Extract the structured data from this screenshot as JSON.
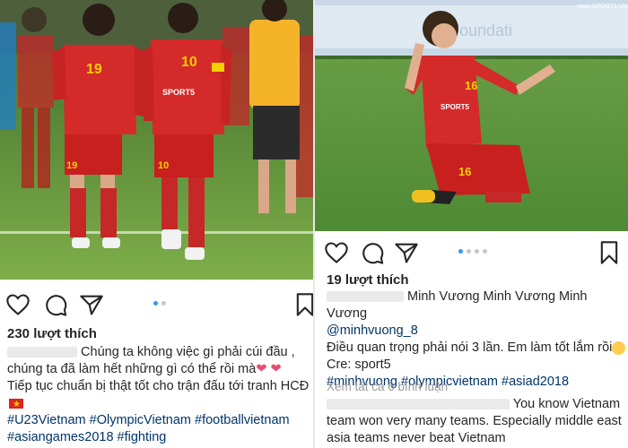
{
  "left_post": {
    "photo": {
      "players": [
        {
          "number": "19",
          "sponsor": "SPORT5"
        },
        {
          "number": "10",
          "sponsor": "SPORT5"
        },
        {
          "number": "19",
          "sponsor": "SPORT5"
        },
        {
          "number": "10",
          "sponsor": "SPORT5"
        }
      ]
    },
    "carousel": {
      "count": 2,
      "active": 0
    },
    "likes": "230 lượt thích",
    "caption_lines": [
      "Chúng ta không việc gì phải cúi đầu ,",
      "chúng ta đã làm hết những gì có thể rồi mà",
      "Tiếp tục chuẩn bị thật tốt cho trận đấu tới tranh HCĐ"
    ],
    "hashtags_line1": "#U23Vietnam #OlympicVietnam #footballvietnam",
    "hashtags_line2": "#asiangames2018 #fighting"
  },
  "right_post": {
    "photo": {
      "watermark": "www.SPORT5.VN",
      "players": [
        {
          "number": "16",
          "sponsor": "SPORT5"
        },
        {
          "number": "16",
          "sponsor": "SPORT5"
        }
      ]
    },
    "carousel": {
      "count": 4,
      "active": 0
    },
    "likes": "19 lượt thích",
    "caption_name": "Minh Vương Minh Vương Minh Vương",
    "mention": "@minhvuong_8",
    "caption_line": "Điều quan trọng phải nói 3 lần. Em làm tốt lắm rồi",
    "credit": "Cre: sport5",
    "hashtags": "#minhvuong #olympicvietnam #asiad2018",
    "view_comments": "Xem tất cả 6 bình luận",
    "comment_lines": [
      "You know Vietnam",
      "team won very many teams. Especially middle east",
      "asia teams never beat Vietnam"
    ]
  },
  "colors": {
    "jersey": "#d42a2a",
    "grass": "#5c9a3c",
    "hashtag": "#003569",
    "carousel_active": "#3897f0"
  },
  "icons": [
    "heart-icon",
    "comment-icon",
    "share-icon",
    "bookmark-icon",
    "flag-icon",
    "heart-emoji",
    "smile-emoji"
  ]
}
